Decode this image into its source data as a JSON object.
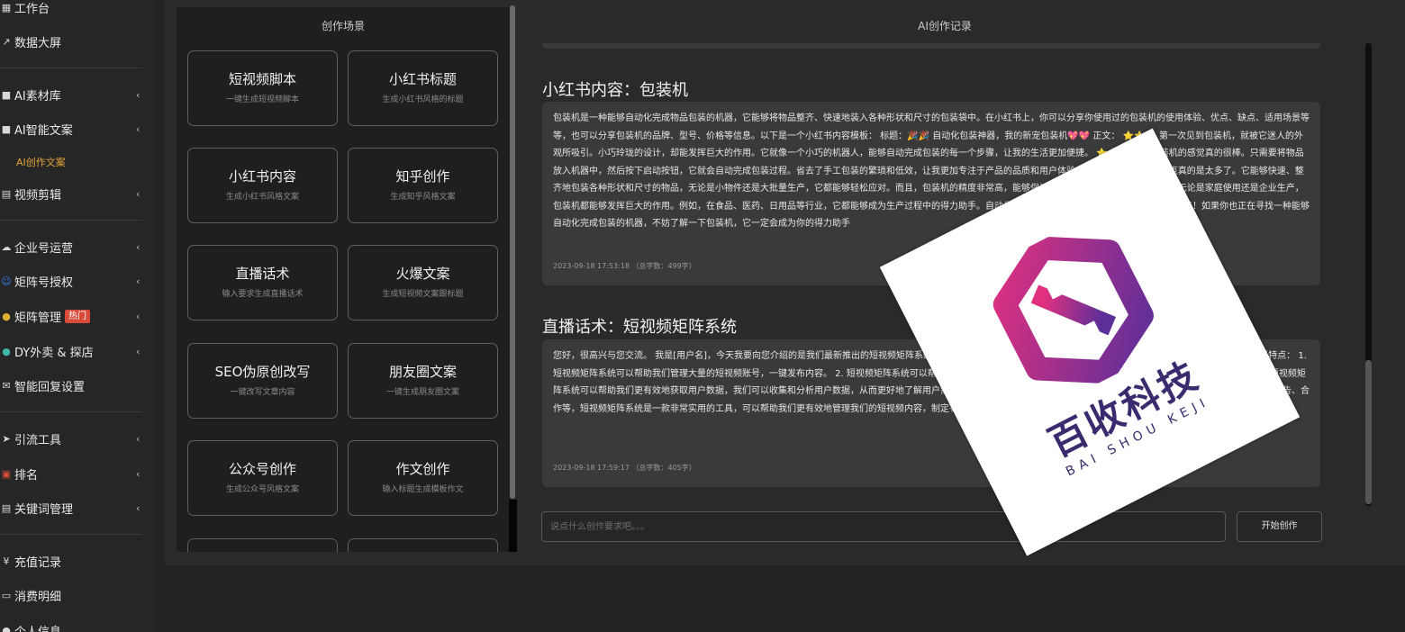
{
  "sidebar": {
    "items": [
      {
        "icon": "desk-icon",
        "glyph": "▦",
        "label": "工作台",
        "chevron": false
      },
      {
        "icon": "chart-icon",
        "glyph": "↗",
        "label": "数据大屏",
        "chevron": false
      },
      {
        "icon": "folder-icon",
        "glyph": "■",
        "label": "AI素材库",
        "chevron": true
      },
      {
        "icon": "folder-icon",
        "glyph": "■",
        "label": "AI智能文案",
        "chevron": true
      },
      {
        "icon": "video-icon",
        "glyph": "▤",
        "label": "视频剪辑",
        "chevron": true
      },
      {
        "icon": "cloud-icon",
        "glyph": "☁",
        "label": "企业号运营",
        "chevron": true
      },
      {
        "icon": "user-icon",
        "glyph": "☺",
        "label": "矩阵号授权",
        "chevron": true
      },
      {
        "icon": "coin-icon",
        "glyph": "●",
        "label": "矩阵管理",
        "badge": "热门",
        "chevron": true
      },
      {
        "icon": "globe-icon",
        "glyph": "●",
        "label": "DY外卖 & 探店",
        "chevron": true
      },
      {
        "icon": "mail-icon",
        "glyph": "✉",
        "label": "智能回复设置",
        "chevron": false
      },
      {
        "icon": "send-icon",
        "glyph": "➤",
        "label": "引流工具",
        "chevron": true
      },
      {
        "icon": "rank-icon",
        "glyph": "▣",
        "label": "排名",
        "chevron": true
      },
      {
        "icon": "doc-icon",
        "glyph": "▤",
        "label": "关键词管理",
        "chevron": true
      },
      {
        "icon": "yen-icon",
        "glyph": "¥",
        "label": "充值记录",
        "chevron": false
      },
      {
        "icon": "card-icon",
        "glyph": "▭",
        "label": "消费明细",
        "chevron": false
      },
      {
        "icon": "person-icon",
        "glyph": "●",
        "label": "个人信息",
        "chevron": false
      }
    ],
    "sub_active": "AI创作文案"
  },
  "scene": {
    "title": "创作场景",
    "cards": [
      {
        "title": "短视频脚本",
        "subtitle": "一键生成短视频脚本"
      },
      {
        "title": "小红书标题",
        "subtitle": "生成小红书风格的标题"
      },
      {
        "title": "小红书内容",
        "subtitle": "生成小红书风格文案"
      },
      {
        "title": "知乎创作",
        "subtitle": "生成知乎风格文案"
      },
      {
        "title": "直播话术",
        "subtitle": "输入要求生成直播话术"
      },
      {
        "title": "火爆文案",
        "subtitle": "生成短视频文案跟标题"
      },
      {
        "title": "SEO伪原创改写",
        "subtitle": "一键改写文章内容"
      },
      {
        "title": "朋友圈文案",
        "subtitle": "一键生成朋友圈文案"
      },
      {
        "title": "公众号创作",
        "subtitle": "生成公众号风格文案"
      },
      {
        "title": "作文创作",
        "subtitle": "输入标题生成模板作文"
      }
    ]
  },
  "records": {
    "title": "AI创作记录",
    "items": [
      {
        "heading": "小红书内容：包装机",
        "body": "包装机是一种能够自动化完成物品包装的机器，它能够将物品整齐、快速地装入各种形状和尺寸的包装袋中。在小红书上，你可以分享你使用过的包装机的使用体验、优点、缺点、适用场景等等，也可以分享包装机的品牌、型号、价格等信息。以下是一个小红书内容模板： 标题：🎉🎉 自动化包装神器，我的新宠包装机💖💖 正文： ⭐⭐⭐ 第一次见到包装机，就被它迷人的外观所吸引。小巧玲珑的设计，却能发挥巨大的作用。它就像一个小巧的机器人，能够自动完成包装的每一个步骤，让我的生活更加便捷。 ⭐⭐⭐ 使用包装机的感觉真的很棒。只需要将物品放入机器中，然后按下启动按钮，它就会自动完成包装过程。省去了手工包装的繁琐和低效，让我更加专注于产品的品质和用户体验。 ⭐⭐⭐ 包装机的优点真的是太多了。它能够快速、整齐地包装各种形状和尺寸的物品，无论是小物件还是大批量生产，它都能够轻松应对。而且，包装机的精度非常高，能够保证包装的整齐和一致性。 ⭐⭐⭐ 无论是家庭使用还是企业生产，包装机都能够发挥巨大的作用。例如，在食品、医药、日用品等行业，它都能够成为生产过程中的得力助手。自动化包装神器——我的新宠包装机，真的是太棒了！如果你也正在寻找一种能够自动化完成包装的机器，不妨了解一下包装机，它一定会成为你的得力助手",
        "meta": "2023-09-18 17:53:18 （总字数：499字）"
      },
      {
        "heading": "直播话术：短视频矩阵系统",
        "body": "您好，很高兴与您交流。 我是[用户名]，今天我要向您介绍的是我们最新推出的短视频矩阵系统，它可以帮助我们更好地管理短视频内容，提升我们的影响力。 它具备以下几个主要特点： 1. 短视频矩阵系统可以帮助我们管理大量的短视频账号，一键发布内容。 2. 短视频矩阵系统可以帮助我们制定有效的内容策略，我们可以根据不同的受众群体制定不同的短视频内容。短视频矩阵系统可以帮助我们更有效地获取用户数据，我们可以收集和分析用户数据，从而更好地了解用户需求。可以帮助我们更有效地推广内容，我们可以使用多种推广方式，如社交媒体、广告、合作等，短视频矩阵系统是一款非常实用的工具，可以帮助我们更有效地管理我们的短视频内容，制定有效的内容策略，获取用户数据和推广内容。",
        "meta": "2023-09-18 17:59:17 （总字数：405字）"
      }
    ]
  },
  "input": {
    "placeholder": "说点什么创作要求吧。。。"
  },
  "start_button": "开始创作",
  "logo": {
    "name": "百收科技",
    "latin": "BAI SHOU KEJI"
  },
  "colors": {
    "badge": "#d84a3a",
    "accent_sub": "#e2a23a",
    "logo_text": "#3b2a6e"
  }
}
